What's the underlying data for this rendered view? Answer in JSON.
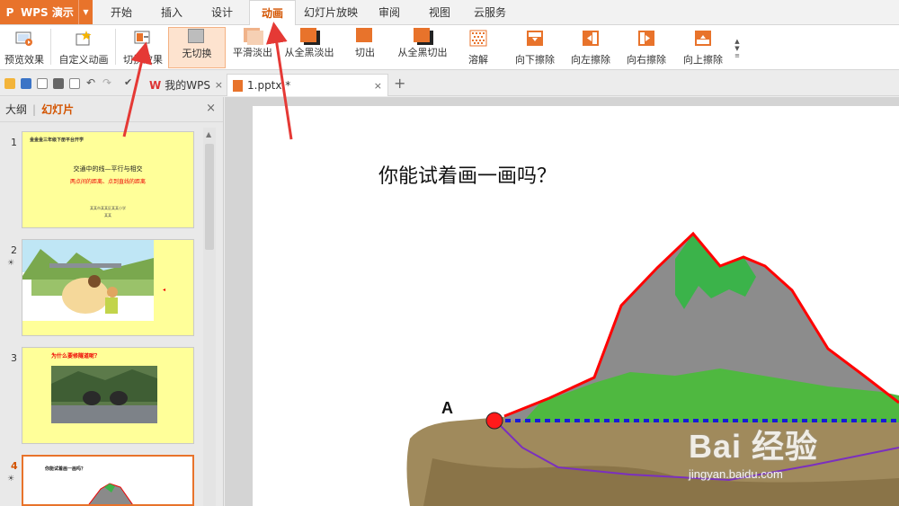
{
  "app": {
    "logo_letter": "P",
    "name": "WPS 演示",
    "dropdown_glyph": "▼"
  },
  "menu": {
    "tabs": [
      "开始",
      "插入",
      "设计",
      "动画",
      "幻灯片放映",
      "审阅",
      "视图",
      "云服务"
    ],
    "active": "动画"
  },
  "ribbon": {
    "preview": "预览效果",
    "custom_animation": "自定义动画",
    "transition_effect": "切换效果",
    "transitions": [
      "无切换",
      "平滑淡出",
      "从全黑淡出",
      "切出",
      "从全黑切出",
      "溶解",
      "向下擦除",
      "向左擦除",
      "向右擦除",
      "向上擦除"
    ],
    "selected_transition": "无切换"
  },
  "doc_tabs": {
    "home": "我的WPS",
    "file": "1.pptx *",
    "close_glyph": "×",
    "new_tab_glyph": "+"
  },
  "left_panel": {
    "tab_outline": "大纲",
    "tab_slides": "幻灯片",
    "close_glyph": "×",
    "slide_numbers": [
      "1",
      "2",
      "3",
      "4"
    ],
    "slide1": {
      "header": "金金金三年级下册平台开学",
      "title": "交通中的线—平行与相交",
      "subtitle": "两点间的距离、点到直线的距离",
      "footer1": "某某市某某区某某小学",
      "footer2": "某某"
    },
    "slide3": {
      "title": "为什么要修隧道呢？"
    },
    "slide4": {
      "title": "你能试着画一画吗？"
    }
  },
  "slide": {
    "title": "你能试着画一画吗？",
    "point_label": "A"
  },
  "watermark": {
    "main": "Bai 经验",
    "sub": "jingyan.baidu.com"
  },
  "colors": {
    "accent": "#e8732b",
    "active_text": "#d35400",
    "thumb_bg": "#ffff99",
    "mountain_outline": "#ff0000",
    "path_dotted": "#1a1ad6",
    "path_purple": "#7b2fbf"
  }
}
